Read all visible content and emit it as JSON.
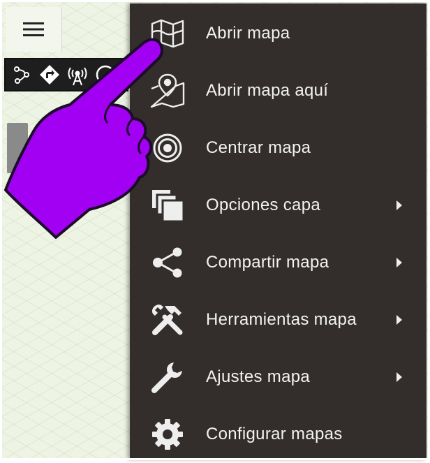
{
  "colors": {
    "menu_background": "#332e2b",
    "menu_text": "#f3f3f3",
    "hand_fill": "#a100f2",
    "map_background": "#eef4e4"
  },
  "header": {
    "menu_icon": "hamburger-menu-icon"
  },
  "toolbar": {
    "icons": [
      "route-icon",
      "navigation-direction-icon",
      "radio-tower-icon",
      "compass-icon"
    ]
  },
  "menu": {
    "items": [
      {
        "label": "Abrir mapa",
        "icon": "map-icon",
        "has_submenu": false
      },
      {
        "label": "Abrir mapa aquí",
        "icon": "map-pin-icon",
        "has_submenu": false
      },
      {
        "label": "Centrar mapa",
        "icon": "target-icon",
        "has_submenu": false
      },
      {
        "label": "Opciones capa",
        "icon": "layers-icon",
        "has_submenu": true
      },
      {
        "label": "Compartir mapa",
        "icon": "share-icon",
        "has_submenu": true
      },
      {
        "label": "Herramientas mapa",
        "icon": "tools-icon",
        "has_submenu": true
      },
      {
        "label": "Ajustes mapa",
        "icon": "wrench-icon",
        "has_submenu": true
      },
      {
        "label": "Configurar mapas",
        "icon": "gear-icon",
        "has_submenu": false
      }
    ]
  },
  "overlay": {
    "pointer": "pointing-hand-icon"
  }
}
